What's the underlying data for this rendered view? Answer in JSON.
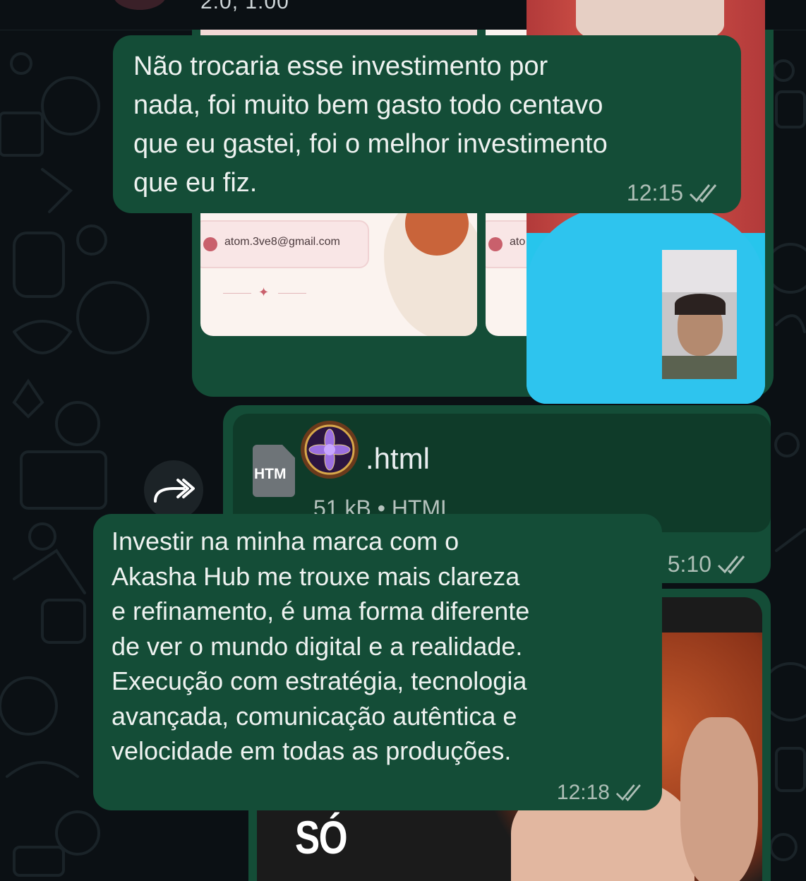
{
  "header": {
    "subtitle_partial": "2:0, 1:00"
  },
  "forwarded_card": {
    "email": "atom.3ve8@gmail.com",
    "email_partial": "ato"
  },
  "messages": [
    {
      "id": "msg1",
      "lines": [
        "Não trocaria esse investimento por",
        "nada, foi muito bem gasto todo centavo",
        "que eu gastei, foi o melhor investimento",
        "que eu fiz."
      ],
      "time": "12:15",
      "status": "read"
    },
    {
      "id": "msg2",
      "lines": [
        "Investir na minha marca com o",
        "Akasha Hub me trouxe mais clareza",
        "e refinamento, é uma forma diferente",
        "de ver o mundo digital e a realidade.",
        "Execução com estratégia, tecnologia",
        "avançada, comunicação autêntica e",
        "velocidade em todas as produções."
      ],
      "time": "12:18",
      "status": "read"
    }
  ],
  "file_message": {
    "icon_label": "HTM",
    "filename_suffix": ".html",
    "size": "51 kB",
    "separator": "•",
    "type": "HTML",
    "time_partial": "5:10",
    "status": "read"
  },
  "photo_message": {
    "overlay_text": "SÓ"
  },
  "icons": {
    "forward": "forward-icon",
    "read_receipt": "double-check-icon",
    "file": "html-file-icon",
    "mail": "mail-icon"
  },
  "colors": {
    "bubble_outgoing": "#144d37",
    "background": "#0b1014",
    "tick_read": "#aebfb7",
    "video_bg": "#27c5ec"
  }
}
